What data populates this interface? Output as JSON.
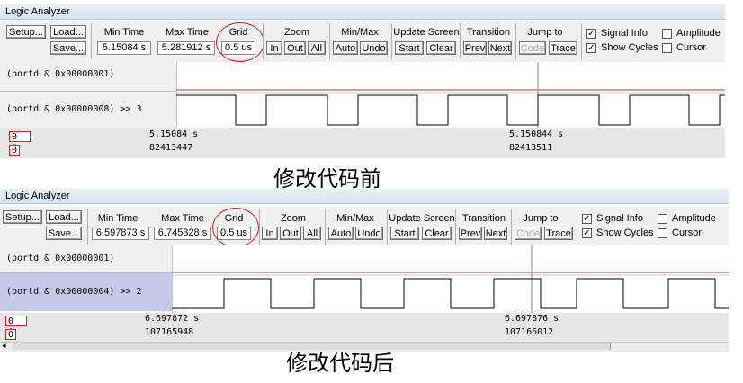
{
  "window_title": "Logic Analyzer",
  "toolbar": {
    "setup": "Setup...",
    "load": "Load...",
    "save": "Save...",
    "min_time_hdr": "Min Time",
    "max_time_hdr": "Max Time",
    "grid_hdr": "Grid",
    "zoom_hdr": "Zoom",
    "zoom_in": "In",
    "zoom_out": "Out",
    "zoom_all": "All",
    "minmax_hdr": "Min/Max",
    "auto": "Auto",
    "undo": "Undo",
    "update_hdr": "Update Screen",
    "start": "Start",
    "clear": "Clear",
    "transition_hdr": "Transition",
    "prev": "Prev",
    "next": "Next",
    "jump_hdr": "Jump to",
    "code": "Code",
    "trace": "Trace",
    "signal_info": "Signal Info",
    "show_cycles": "Show Cycles",
    "amplitude": "Amplitude",
    "cursor": "Cursor"
  },
  "top": {
    "min_time": "5.15084 s",
    "max_time": "5.281912 s",
    "grid": "0.5 us",
    "signals": [
      "(portd & 0x00000001)",
      "(portd & 0x00000008) >> 3"
    ],
    "cursor_left_time": "5.15084 s",
    "cursor_left_cycles": "82413447",
    "cursor_right_time": "5.150844 s",
    "cursor_right_cycles": "82413511",
    "offset": "0 s",
    "zero": "0",
    "caption": "修改代码前"
  },
  "bottom": {
    "min_time": "6.597873 s",
    "max_time": "6.745328 s",
    "grid": "0.5 us",
    "signals": [
      "(portd & 0x00000001)",
      "(portd & 0x00000004) >> 2"
    ],
    "cursor_left_time": "6.697872 s",
    "cursor_left_cycles": "107165948",
    "cursor_right_time": "6.697876 s",
    "cursor_right_cycles": "107166012",
    "offset": "0 s",
    "zero": "0",
    "caption": "修改代码后"
  },
  "colors": {
    "highlight": "#d02020",
    "selected_row": "#c8c8e8"
  }
}
